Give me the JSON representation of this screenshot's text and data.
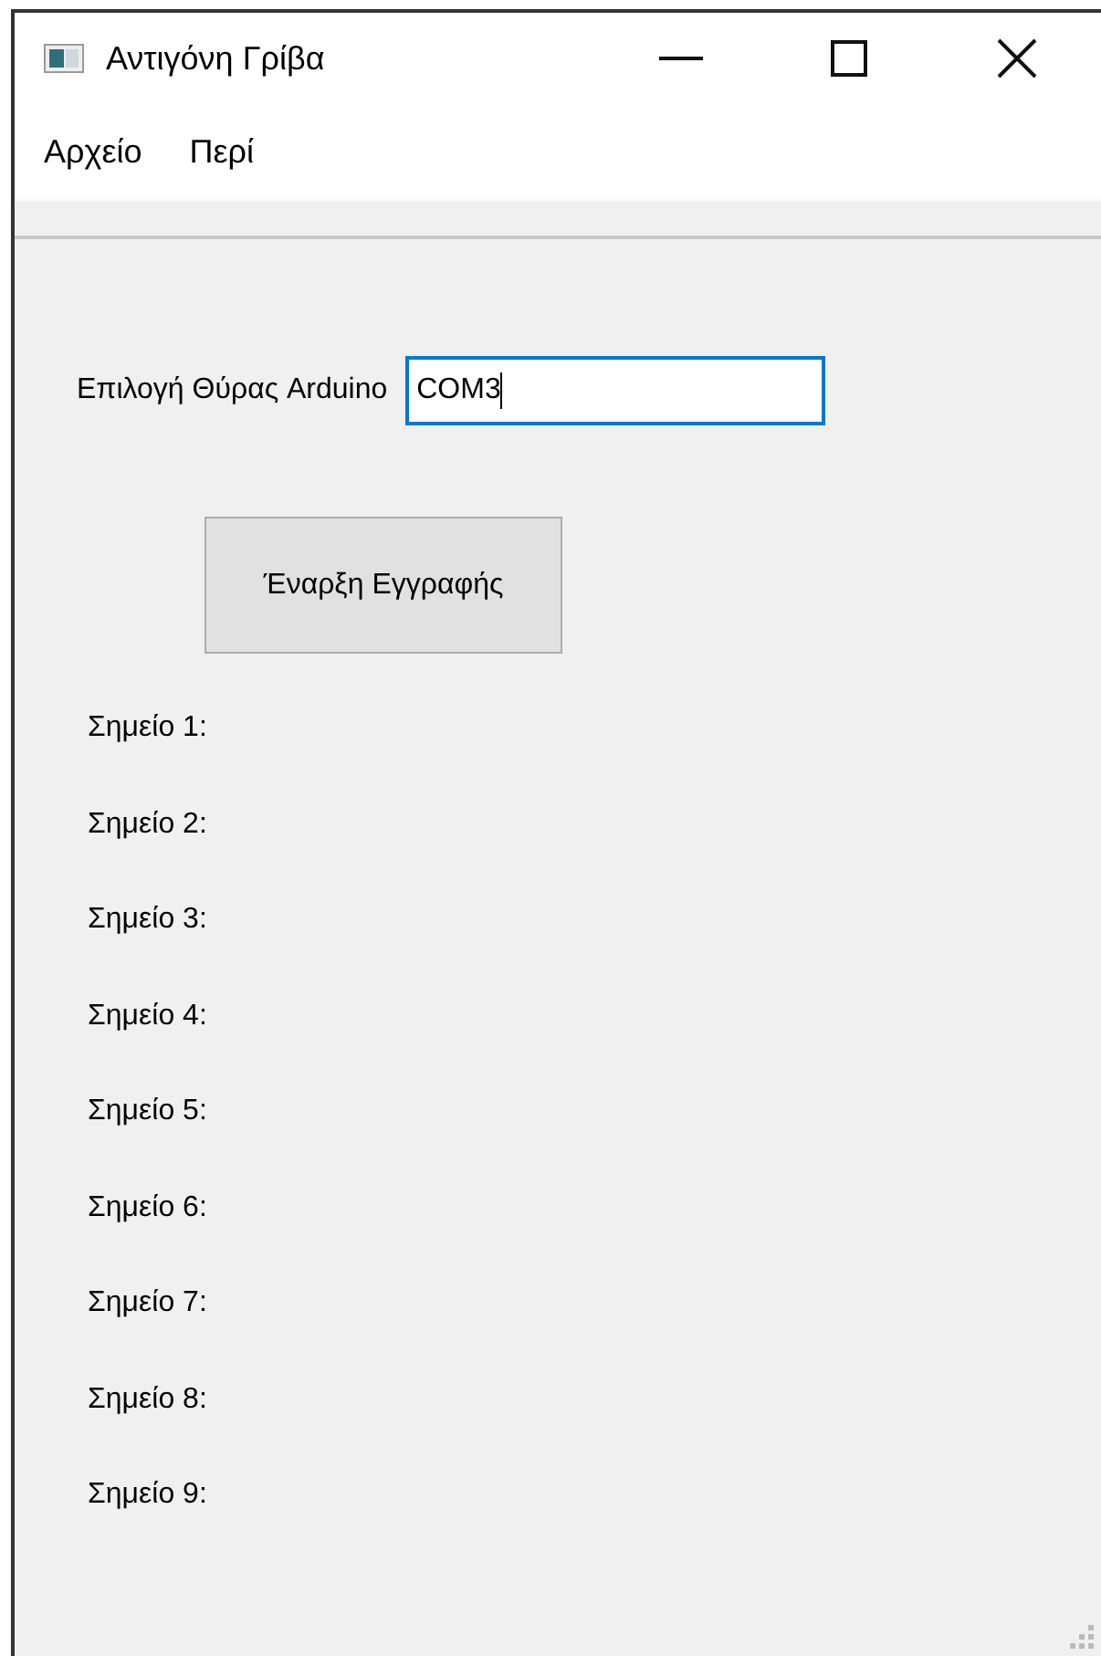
{
  "window": {
    "title": "Αντιγόνη Γρίβα"
  },
  "menu": [
    "Αρχείο",
    "Περί"
  ],
  "port": {
    "label": "Επιλογή Θύρας Arduino",
    "value": "COM3",
    "focused": true
  },
  "start_button": "Έναρξη Εγγραφής",
  "points": [
    "Σημείο 1:",
    "Σημείο 2:",
    "Σημείο 3:",
    "Σημείο 4:",
    "Σημείο 5:",
    "Σημείο 6:",
    "Σημείο 7:",
    "Σημείο 8:",
    "Σημείο 9:"
  ]
}
